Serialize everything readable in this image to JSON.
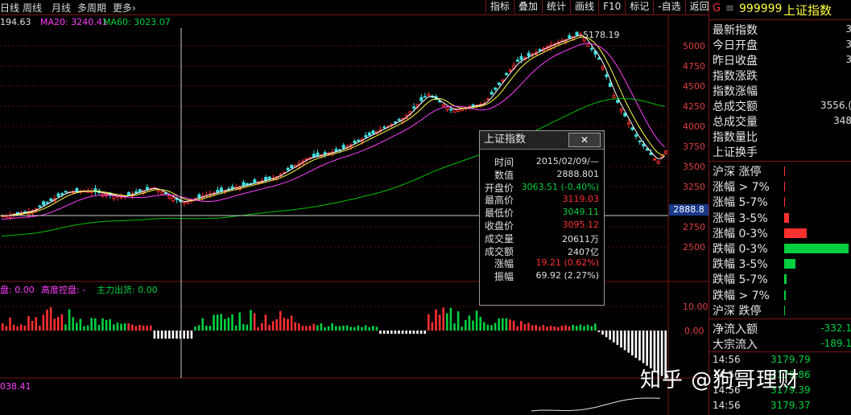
{
  "toolbar": {
    "tabs": [
      "日线",
      "周线",
      "月线",
      "多周期",
      "更多›"
    ],
    "buttons": [
      "指标",
      "叠加",
      "统计",
      "画线",
      "F10",
      "标记",
      "-自选",
      "返回"
    ]
  },
  "ma_line": {
    "ma_prev": "194.63",
    "ma20": "MA20: 3240.41",
    "ma60": "MA60: 3023.07"
  },
  "price_axis": [
    "5000",
    "4750",
    "4500",
    "4250",
    "4000",
    "3750",
    "3500",
    "3250",
    "2750",
    "2500"
  ],
  "crosshair_value": "2888.8",
  "peak_label": "5178.19",
  "lower_axis": [
    "10.00",
    "0.00"
  ],
  "bottom_left_value": "038.41",
  "indicator_line": {
    "a": "盘: 0.00",
    "b": "高度控盘: -",
    "c": "主力出货: 0.00"
  },
  "colors": {
    "up": "#ff3030",
    "down": "#00d040",
    "ma5": "#ffffff",
    "ma10": "#ffff00",
    "ma20": "#ff40ff",
    "ma60": "#00c000"
  },
  "right_panel": {
    "header_letter": "G",
    "code": "999999",
    "name": "上证指数",
    "stats": [
      {
        "label": "最新指数",
        "value": "3"
      },
      {
        "label": "今日开盘",
        "value": "3"
      },
      {
        "label": "昨日收盘",
        "value": "3"
      },
      {
        "label": "指数涨跌",
        "value": ""
      },
      {
        "label": "指数涨幅",
        "value": ""
      },
      {
        "label": "总成交额",
        "value": "3556.("
      },
      {
        "label": "总成交量",
        "value": "348"
      },
      {
        "label": "指数量比",
        "value": ""
      },
      {
        "label": "上证换手",
        "value": ""
      }
    ],
    "limits": [
      "沪深 涨停",
      "涨幅 > 7%",
      "涨幅 5-7%",
      "涨幅 3-5%",
      "涨幅 0-3%",
      "跌幅 0-3%",
      "跌幅 3-5%",
      "跌幅 5-7%",
      "跌幅 > 7%",
      "沪深 跌停"
    ],
    "flows": [
      {
        "label": "净流入额",
        "value": "-332.1"
      },
      {
        "label": "大宗流入",
        "value": "-189.1"
      }
    ],
    "ticks": [
      {
        "time": "14:56",
        "value": "3179.79"
      },
      {
        "time": "14:56",
        "value": "3179.86"
      },
      {
        "time": "14:56",
        "value": "3179.39"
      },
      {
        "time": "14:56",
        "value": "3179.37"
      }
    ]
  },
  "tooltip": {
    "title": "上证指数",
    "close": "✕",
    "rows": [
      {
        "label": "时间",
        "value": "2015/02/09/—"
      },
      {
        "label": "数值",
        "value": "2888.801"
      },
      {
        "label": "开盘价",
        "value": "3063.51 (-0.40%)"
      },
      {
        "label": "最高价",
        "value": "3119.03"
      },
      {
        "label": "最低价",
        "value": "3049.11"
      },
      {
        "label": "收盘价",
        "value": "3095.12"
      },
      {
        "label": "成交量",
        "value": "20611万"
      },
      {
        "label": "成交额",
        "value": "2407亿"
      },
      {
        "label": "涨幅",
        "value": "19.21 (0.62%)"
      },
      {
        "label": "振幅",
        "value": "69.92 (2.27%)"
      }
    ]
  },
  "watermark": "知乎 @狗哥理财"
}
